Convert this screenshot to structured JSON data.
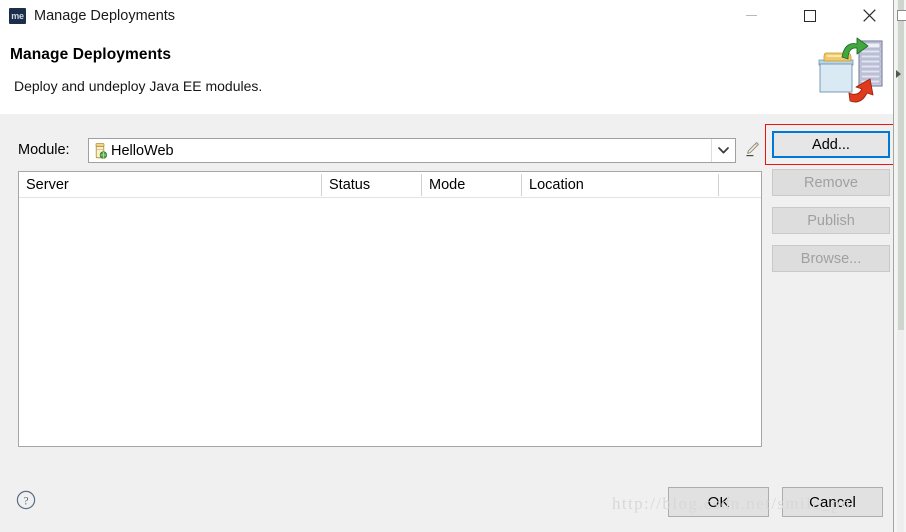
{
  "window": {
    "title": "Manage Deployments",
    "app_icon_label": "me",
    "controls": {
      "minimize": "minimize",
      "maximize": "maximize",
      "close": "close"
    }
  },
  "header": {
    "title": "Manage Deployments",
    "subtitle": "Deploy and undeploy Java EE modules.",
    "banner_icon": "deployment-banner-icon"
  },
  "module": {
    "label": "Module:",
    "selected_value": "HelloWeb",
    "icon": "jar-module-icon",
    "dropdown_icon": "chevron-down-icon",
    "edit_icon": "edit-module-icon"
  },
  "table": {
    "columns": [
      "Server",
      "Status",
      "Mode",
      "Location"
    ],
    "rows": []
  },
  "side_buttons": [
    {
      "label": "Add...",
      "name": "add-button",
      "state": "focused"
    },
    {
      "label": "Remove",
      "name": "remove-button",
      "state": "disabled"
    },
    {
      "label": "Publish",
      "name": "publish-button",
      "state": "disabled"
    },
    {
      "label": "Browse...",
      "name": "browse-button",
      "state": "disabled"
    }
  ],
  "footer": {
    "help_icon": "help-icon",
    "ok_label": "OK",
    "cancel_label": "Cancel"
  },
  "annotation": {
    "highlight_color": "#ee1111",
    "focus_color": "#0078d7",
    "target": "add-button"
  },
  "watermark": {
    "text": "http://blog.csdn.net/smile_po"
  }
}
